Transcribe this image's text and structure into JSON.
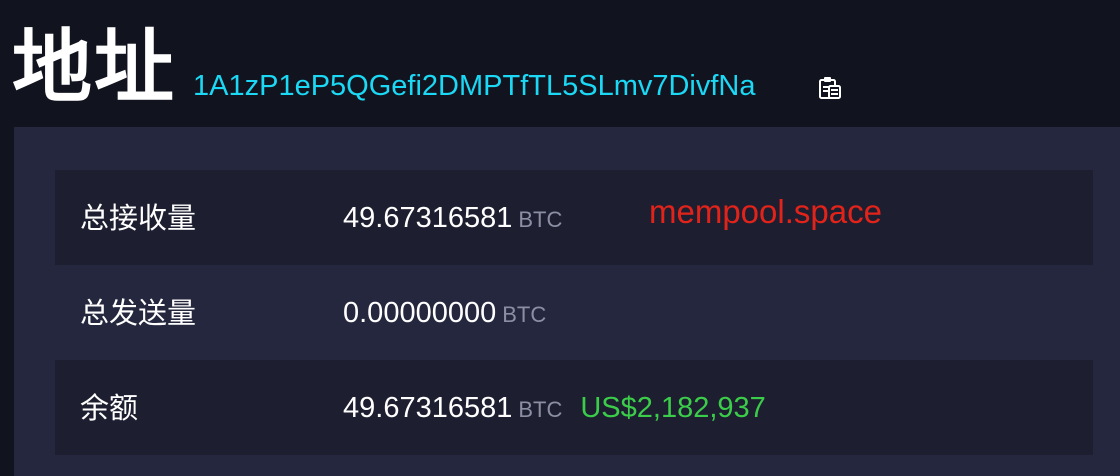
{
  "header": {
    "title": "地址",
    "address": "1A1zP1eP5QGefi2DMPTfTL5SLmv7DivfNa",
    "copy_icon": "clipboard-icon"
  },
  "watermark": "mempool.space",
  "rows": [
    {
      "label": "总接收量",
      "value": "49.67316581",
      "unit": "BTC"
    },
    {
      "label": "总发送量",
      "value": "0.00000000",
      "unit": "BTC"
    },
    {
      "label": "余额",
      "value": "49.67316581",
      "unit": "BTC",
      "fiat": "US$2,182,937"
    }
  ],
  "colors": {
    "background": "#11131f",
    "panel": "#24273e",
    "row_dark": "#1d1f31",
    "address": "#1bd8f4",
    "fiat": "#3bcc49",
    "unit": "#8c8fa3",
    "watermark": "#e2231a"
  }
}
